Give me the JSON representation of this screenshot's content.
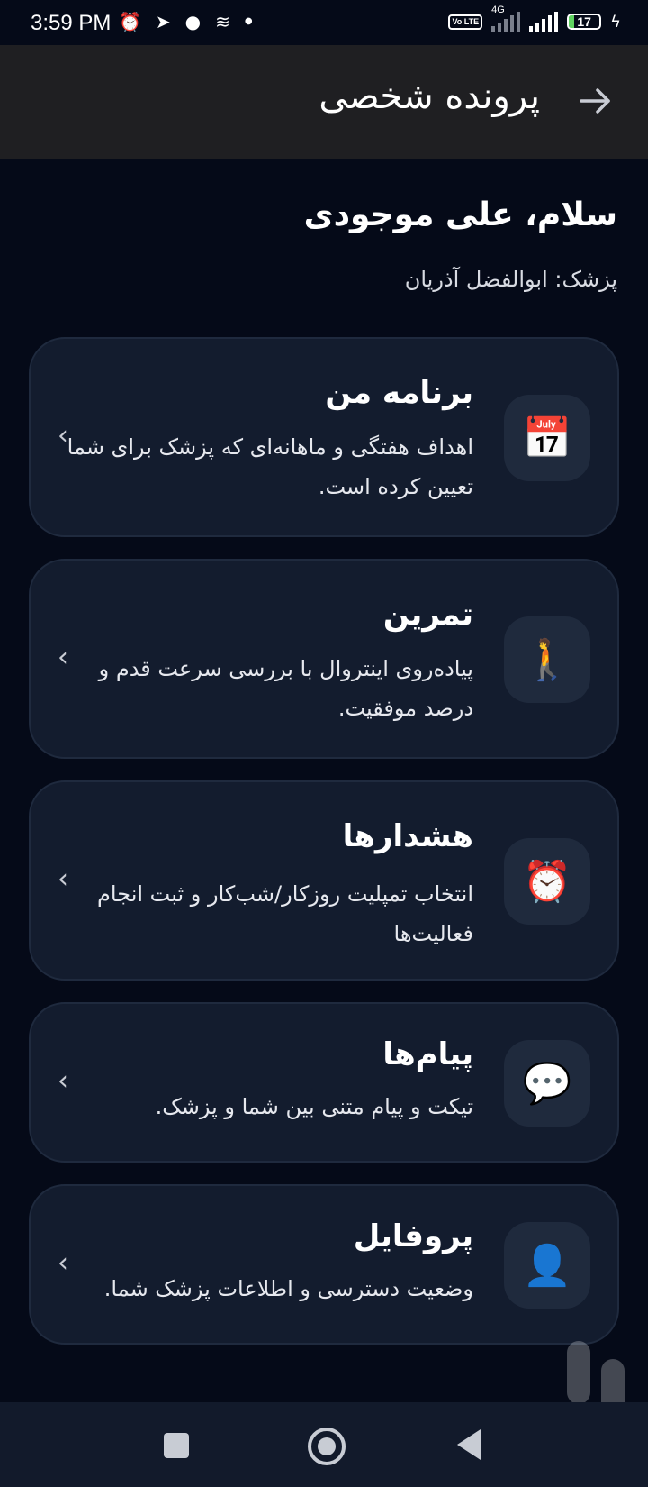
{
  "status_bar": {
    "time": "3:59 PM",
    "left_icons": [
      "alarm-icon",
      "telegram-icon",
      "notification-icon",
      "layers-icon",
      "dot-icon"
    ],
    "network": "4G",
    "volte": "Vo LTE",
    "battery": "17",
    "battery_level": 0.17
  },
  "app_bar": {
    "title": "پرونده شخصی"
  },
  "greeting": "سلام، علی موجودی",
  "doctor_line": "پزشک: ابوالفضل آذریان",
  "cards": [
    {
      "title": "برنامه من",
      "description": "اهداف هفتگی و ماهانه‌ای که پزشک برای شما تعیین کرده است.",
      "icon": "📅",
      "icon_name": "calendar-icon"
    },
    {
      "title": "تمرین",
      "description": "پیاده‌روی اینتروال با بررسی سرعت قدم و درصد موفقیت.",
      "icon": "🚶",
      "icon_name": "walking-icon"
    },
    {
      "title": "هشدارها",
      "description": "انتخاب تمپلیت روزکار/شب‌کار و ثبت انجام فعالیت‌ها",
      "icon": "⏰",
      "icon_name": "alarm-clock-icon"
    },
    {
      "title": "پیام‌ها",
      "description": "تیکت و پیام متنی بین شما و پزشک.",
      "icon": "💬",
      "icon_name": "speech-bubble-icon"
    },
    {
      "title": "پروفایل",
      "description": "وضعیت دسترسی و اطلاعات پزشک شما.",
      "icon": "👤",
      "icon_name": "user-icon"
    }
  ],
  "chevron": "‹",
  "colors": {
    "background": "#050a18",
    "app_bar": "#1f1f22",
    "card": "#131c2e",
    "icon_box": "#1f2a3d",
    "nav_bar": "#121a2b"
  }
}
